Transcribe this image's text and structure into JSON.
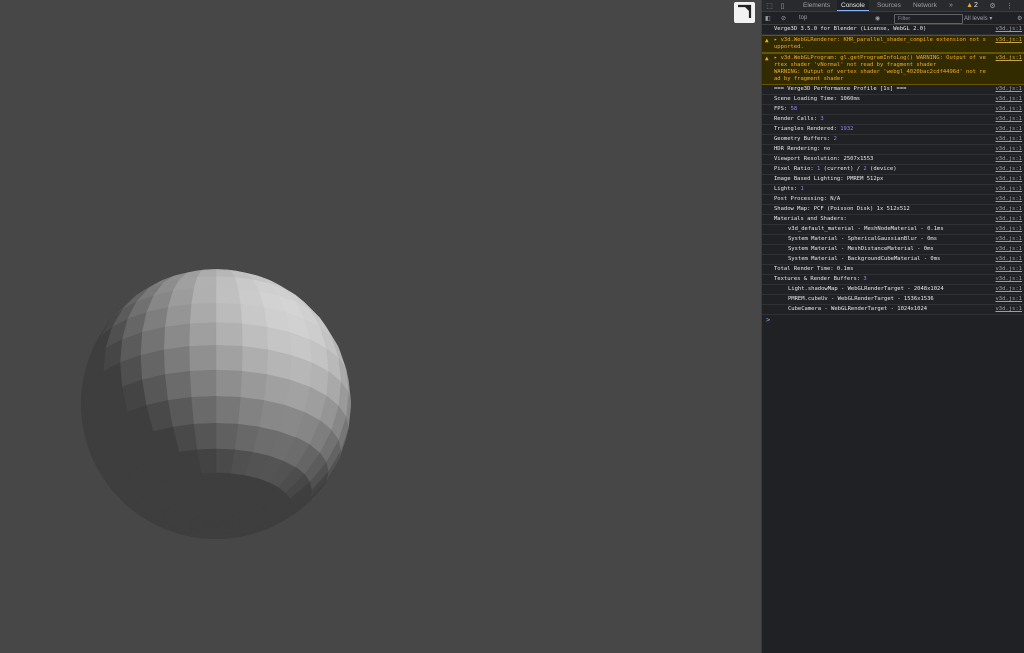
{
  "devtools": {
    "tabs": [
      "Elements",
      "Console",
      "Sources",
      "Network"
    ],
    "active_tab": "Console",
    "more_tabs": "»",
    "warning_count": "2",
    "context": "top",
    "filter_placeholder": "Filter",
    "levels": "All levels ▾"
  },
  "console": {
    "src": "v3d.js:1",
    "rows": [
      {
        "type": "log",
        "text": "Verge3D 3.5.0 for Blender (License, WebGL 2.0)"
      },
      {
        "type": "warn",
        "text": "▸ v3d.WebGLRenderer: KHR_parallel_shader_compile extension not supported."
      },
      {
        "type": "warn",
        "text": "▸ v3d.WebGLProgram: gl.getProgramInfoLog() WARNING: Output of vertex shader 'vNormal' not read by fragment shader\nWARNING: Output of vertex shader 'webgl_4020bac2cdf4496d' not read by fragment shader"
      },
      {
        "type": "log",
        "text": "=== Verge3D Performance Profile [1s] ==="
      },
      {
        "type": "log",
        "text": "Scene Loading Time: 1060ms"
      },
      {
        "type": "log",
        "label": "FPS: ",
        "num": "58"
      },
      {
        "type": "log",
        "label": "Render Calls: ",
        "num": "3"
      },
      {
        "type": "log",
        "label": "Triangles Rendered: ",
        "num": "1932"
      },
      {
        "type": "log",
        "label": "Geometry Buffers: ",
        "num": "2"
      },
      {
        "type": "log",
        "text": "HDR Rendering: no"
      },
      {
        "type": "log",
        "text": "Viewport Resolution: 2507x1553"
      },
      {
        "type": "log",
        "label": "Pixel Ratio: ",
        "num": "1",
        "rest": " (current) / ",
        "num2": "2",
        "rest2": " (device)"
      },
      {
        "type": "log",
        "text": "Image Based Lighting: PMREM 512px"
      },
      {
        "type": "log",
        "label": "Lights: ",
        "num": "1"
      },
      {
        "type": "log",
        "text": "Post Processing: N/A"
      },
      {
        "type": "log",
        "text": "Shadow Map: PCF (Poisson Disk) 1x 512x512"
      },
      {
        "type": "log",
        "text": "Materials and Shaders:"
      },
      {
        "type": "log",
        "indent": true,
        "text": "v3d_default_material - MeshNodeMaterial - 0.1ms"
      },
      {
        "type": "log",
        "indent": true,
        "text": "System Material - SphericalGaussianBlur - 0ms"
      },
      {
        "type": "log",
        "indent": true,
        "text": "System Material - MeshDistanceMaterial - 0ms"
      },
      {
        "type": "log",
        "indent": true,
        "text": "System Material - BackgroundCubeMaterial - 0ms"
      },
      {
        "type": "log",
        "text": "Total Render Time: 0.1ms"
      },
      {
        "type": "log",
        "label": "Textures & Render Buffers: ",
        "num": "3"
      },
      {
        "type": "log",
        "indent": true,
        "text": "Light.shadowMap - WebGLRenderTarget - 2048x1024"
      },
      {
        "type": "log",
        "indent": true,
        "text": "PMREM.cubeUv - WebGLRenderTarget - 1536x1536"
      },
      {
        "type": "log",
        "indent": true,
        "text": "CubeCamera - WebGLRenderTarget - 1024x1024"
      }
    ],
    "prompt": ">"
  },
  "colors": {
    "viewport_bg": "#474747",
    "devtools_bg": "#202124",
    "warning": "#f2ab26",
    "number": "#9980ff"
  }
}
